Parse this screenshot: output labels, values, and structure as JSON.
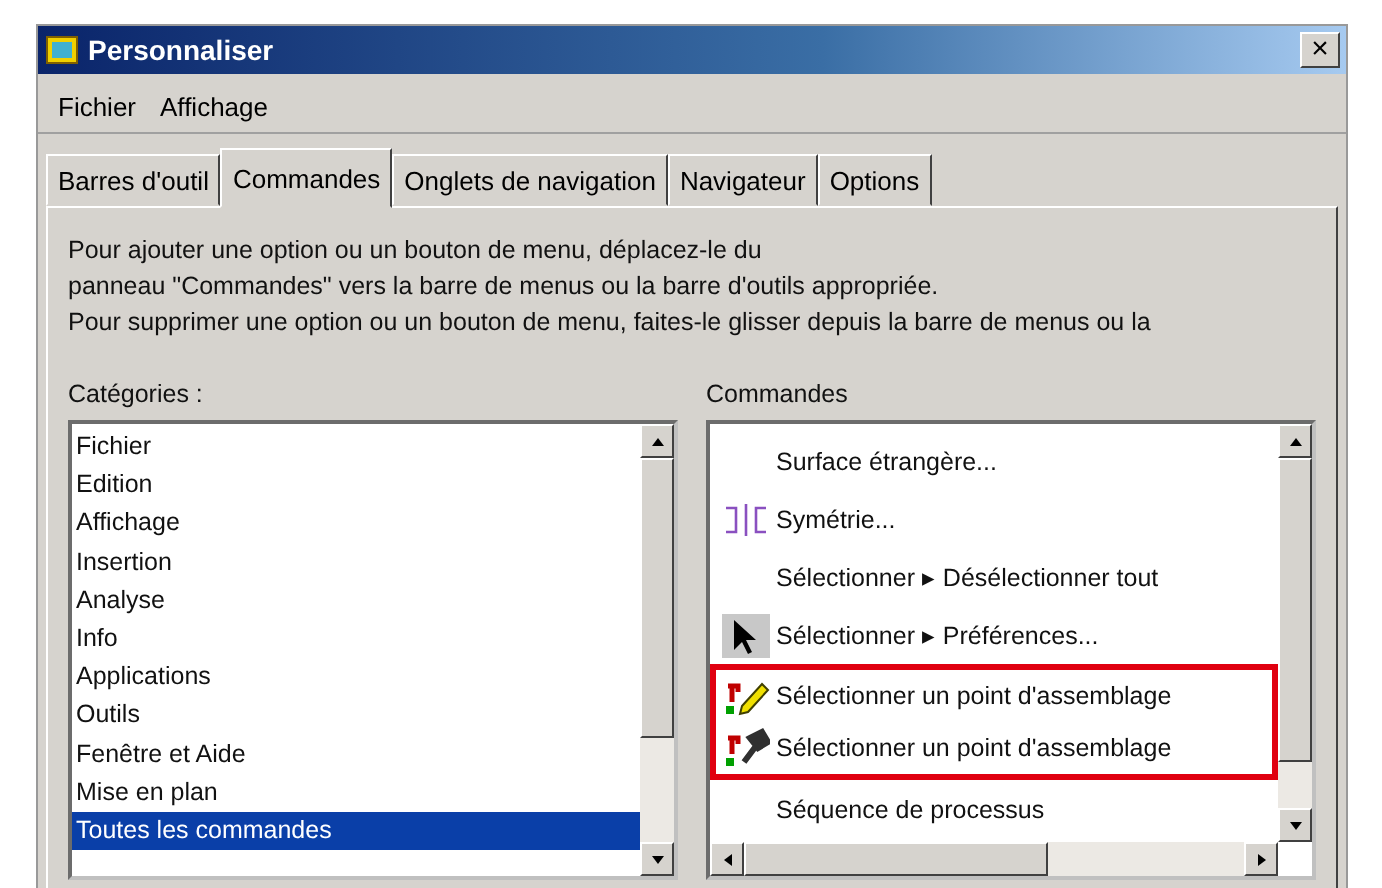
{
  "window": {
    "title": "Personnaliser",
    "close": "×"
  },
  "menu": [
    "Fichier",
    "Affichage"
  ],
  "tabs": [
    {
      "label": "Barres d'outil",
      "selected": false
    },
    {
      "label": "Commandes",
      "selected": true
    },
    {
      "label": "Onglets de navigation",
      "selected": false
    },
    {
      "label": "Navigateur",
      "selected": false
    },
    {
      "label": "Options",
      "selected": false
    }
  ],
  "description": [
    "Pour ajouter une option ou un bouton de menu, déplacez-le du",
    "panneau \"Commandes\" vers la barre de menus ou la barre d'outils appropriée.",
    "Pour supprimer une option ou un bouton de menu, faites-le glisser depuis la barre de menus ou la"
  ],
  "categories": {
    "label": "Catégories :",
    "items": [
      {
        "label": "Fichier",
        "selected": false
      },
      {
        "label": "Edition",
        "selected": false
      },
      {
        "label": "Affichage",
        "selected": false
      },
      {
        "label": "Insertion",
        "selected": false
      },
      {
        "label": "Analyse",
        "selected": false
      },
      {
        "label": "Info",
        "selected": false
      },
      {
        "label": "Applications",
        "selected": false
      },
      {
        "label": "Outils",
        "selected": false
      },
      {
        "label": "Fenêtre et Aide",
        "selected": false
      },
      {
        "label": "Mise en plan",
        "selected": false
      },
      {
        "label": "Toutes les commandes",
        "selected": true
      }
    ]
  },
  "commands": {
    "label": "Commandes",
    "items": [
      {
        "label": "Surface étrangère...",
        "kind": "plain",
        "highlighted": false
      },
      {
        "label": "Symétrie...",
        "kind": "symmetry",
        "highlighted": false
      },
      {
        "label": "Sélectionner ▸ Désélectionner tout",
        "kind": "plain",
        "highlighted": false
      },
      {
        "label": "Sélectionner ▸ Préférences...",
        "kind": "pointer",
        "highlighted": false
      },
      {
        "label": "Sélectionner un point d'assemblage",
        "kind": "pencil",
        "highlighted": true
      },
      {
        "label": "Sélectionner un point d'assemblage",
        "kind": "hammer",
        "highlighted": true
      },
      {
        "label": "Séquence de processus",
        "kind": "plain",
        "highlighted": false
      }
    ]
  }
}
